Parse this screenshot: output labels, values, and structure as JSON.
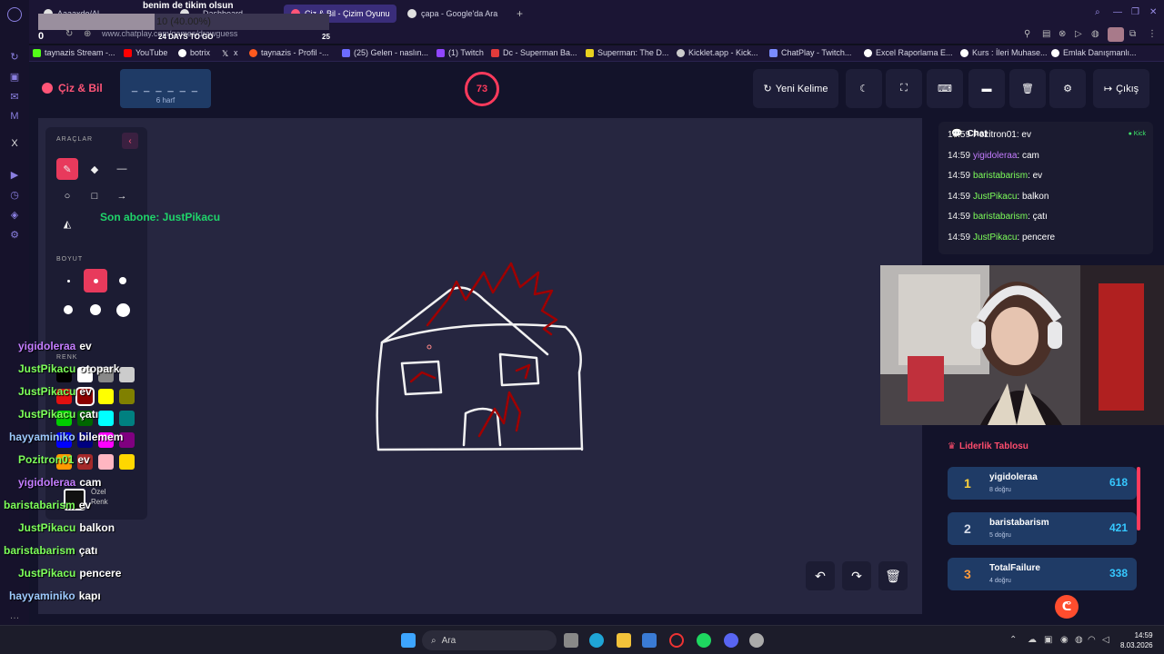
{
  "browser": {
    "tabs": [
      {
        "label": "Aaaaxdo/Al..."
      },
      {
        "label": "... Dashboard"
      },
      {
        "label": "Çiz & Bil - Çizim Oyunu"
      },
      {
        "label": "çapa - Google'da Ara"
      }
    ],
    "url": "www.chatplay.com/games/drawguess",
    "bookmarks": [
      {
        "label": "taynazis Stream -...",
        "color": "#53fc18"
      },
      {
        "label": "YouTube",
        "color": "#ff0000"
      },
      {
        "label": "botrix",
        "color": "#ffffff"
      },
      {
        "label": "x",
        "color": "#ffffff"
      },
      {
        "label": "taynazis - Profil -...",
        "color": "#ff5a1f"
      },
      {
        "label": "(25) Gelen - naslın...",
        "color": "#6c6cff"
      },
      {
        "label": "(1) Twitch",
        "color": "#9146ff"
      },
      {
        "label": "Dc - Superman Ba...",
        "color": "#e23b3b"
      },
      {
        "label": "Superman: The D...",
        "color": "#e8d11f"
      },
      {
        "label": "Kicklet.app - Kick...",
        "color": "#cccccc"
      },
      {
        "label": "ChatPlay - Twitch...",
        "color": "#7a8cff"
      },
      {
        "label": "Excel Raporlama E...",
        "color": "#ffffff"
      },
      {
        "label": "Kurs : İleri Muhase...",
        "color": "#ffffff"
      },
      {
        "label": "Emlak Danışmanlı...",
        "color": "#ffffff"
      }
    ]
  },
  "sub_goal": {
    "title": "benim de tikim olsun",
    "progress_text": "10 (40.00%)",
    "progress_fraction": 0.4,
    "days_left": "24 DAYS TO GO",
    "start": "0",
    "end": "25"
  },
  "app": {
    "brand": "Çiz & Bil",
    "word_mask": "_ _ _ _ _ _",
    "word_length": "6 harf",
    "timer": "73",
    "new_word_label": "Yeni Kelime",
    "exit_label": "Çıkış"
  },
  "tools": {
    "label_tools": "ARAÇLAR",
    "label_size": "BOYUT",
    "label_colors": "RENK",
    "custom_color_line1": "Özel",
    "custom_color_line2": "Renk",
    "swatches": [
      "#000000",
      "#ffffff",
      "#888888",
      "#cccccc",
      "#e01010",
      "#8b0000",
      "#ffff00",
      "#808000",
      "#00cc00",
      "#006600",
      "#00ffff",
      "#008080",
      "#0000ff",
      "#000080",
      "#ff00ff",
      "#800080",
      "#ff9900",
      "#a52a2a",
      "#ffb6c1",
      "#ffd700"
    ]
  },
  "sub_alert": "Son abone: JustPikacu",
  "chat": {
    "title": "Chat",
    "platform": "Kick",
    "messages": [
      {
        "time": "14:59",
        "user": "Pozitron01",
        "text": "ev",
        "color": "#ffffff"
      },
      {
        "time": "14:59",
        "user": "yigidoleraa",
        "text": "cam",
        "color": "#c47dff"
      },
      {
        "time": "14:59",
        "user": "baristabarism",
        "text": "ev",
        "color": "#7dff5a"
      },
      {
        "time": "14:59",
        "user": "JustPikacu",
        "text": "balkon",
        "color": "#7dff5a"
      },
      {
        "time": "14:59",
        "user": "baristabarism",
        "text": "çatı",
        "color": "#7dff5a"
      },
      {
        "time": "14:59",
        "user": "JustPikacu",
        "text": "pencere",
        "color": "#7dff5a"
      }
    ]
  },
  "leaderboard": {
    "title": "Liderlik Tablosu",
    "rows": [
      {
        "rank": "1",
        "name": "yigidoleraa",
        "sub": "8 doğru",
        "score": "618",
        "rank_color": "#ffd23a"
      },
      {
        "rank": "2",
        "name": "baristabarism",
        "sub": "5 doğru",
        "score": "421",
        "rank_color": "#d6dbe8"
      },
      {
        "rank": "3",
        "name": "TotalFailure",
        "sub": "4 doğru",
        "score": "338",
        "rank_color": "#ff9a3a"
      }
    ]
  },
  "overlay_chat": [
    {
      "user": "yigidoleraa",
      "text": "ev",
      "color": "#c47dff"
    },
    {
      "user": "JustPikacu",
      "text": "otopark",
      "color": "#7dff5a"
    },
    {
      "user": "JustPikacu",
      "text": "ev",
      "color": "#7dff5a"
    },
    {
      "user": "JustPikacu",
      "text": "çatı",
      "color": "#7dff5a"
    },
    {
      "user": "hayyaminiko",
      "text": "bilemem",
      "color": "#9ecbff"
    },
    {
      "user": "Pozitron01",
      "text": "ev",
      "color": "#7dff5a"
    },
    {
      "user": "yigidoleraa",
      "text": "cam",
      "color": "#c47dff"
    },
    {
      "user": "baristabarism",
      "text": "ev",
      "color": "#7dff5a"
    },
    {
      "user": "JustPikacu",
      "text": "balkon",
      "color": "#7dff5a"
    },
    {
      "user": "baristabarism",
      "text": "çatı",
      "color": "#7dff5a"
    },
    {
      "user": "JustPikacu",
      "text": "pencere",
      "color": "#7dff5a"
    },
    {
      "user": "hayyaminiko",
      "text": "kapı",
      "color": "#9ecbff"
    }
  ],
  "taskbar": {
    "search_placeholder": "Ara",
    "time": "14:59",
    "date": "8.03.2026"
  }
}
